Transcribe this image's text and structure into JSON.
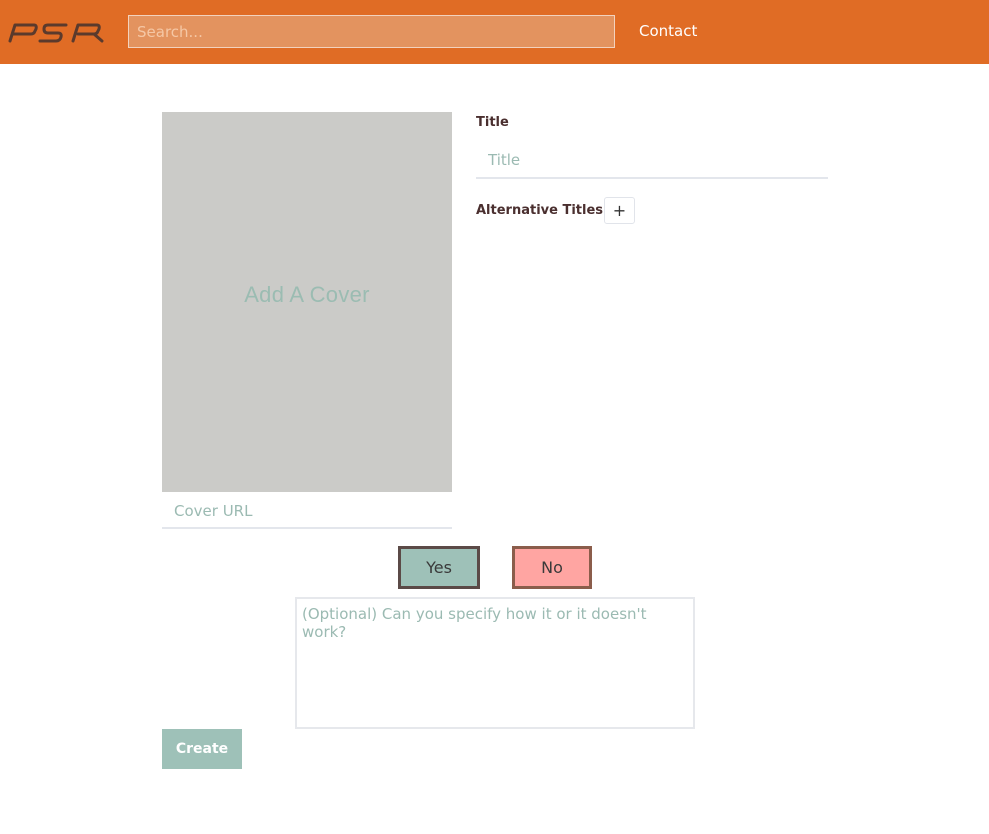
{
  "header": {
    "logo_text": "PSR",
    "search_placeholder": "Search...",
    "contact_label": "Contact"
  },
  "cover": {
    "add_cover_label": "Add A Cover",
    "url_placeholder": "Cover URL"
  },
  "form": {
    "title_label": "Title",
    "title_placeholder": "Title",
    "alt_titles_label": "Alternative Titles",
    "add_alt_title_symbol": "+",
    "yes_label": "Yes",
    "no_label": "No",
    "feedback_placeholder": "(Optional) Can you specify how it or it doesn't work?",
    "create_label": "Create"
  },
  "colors": {
    "header_bg": "#e06c25",
    "accent_teal": "#9ec1b8",
    "no_pink": "#ffa5a2",
    "cover_gray": "#cbcbc8"
  }
}
